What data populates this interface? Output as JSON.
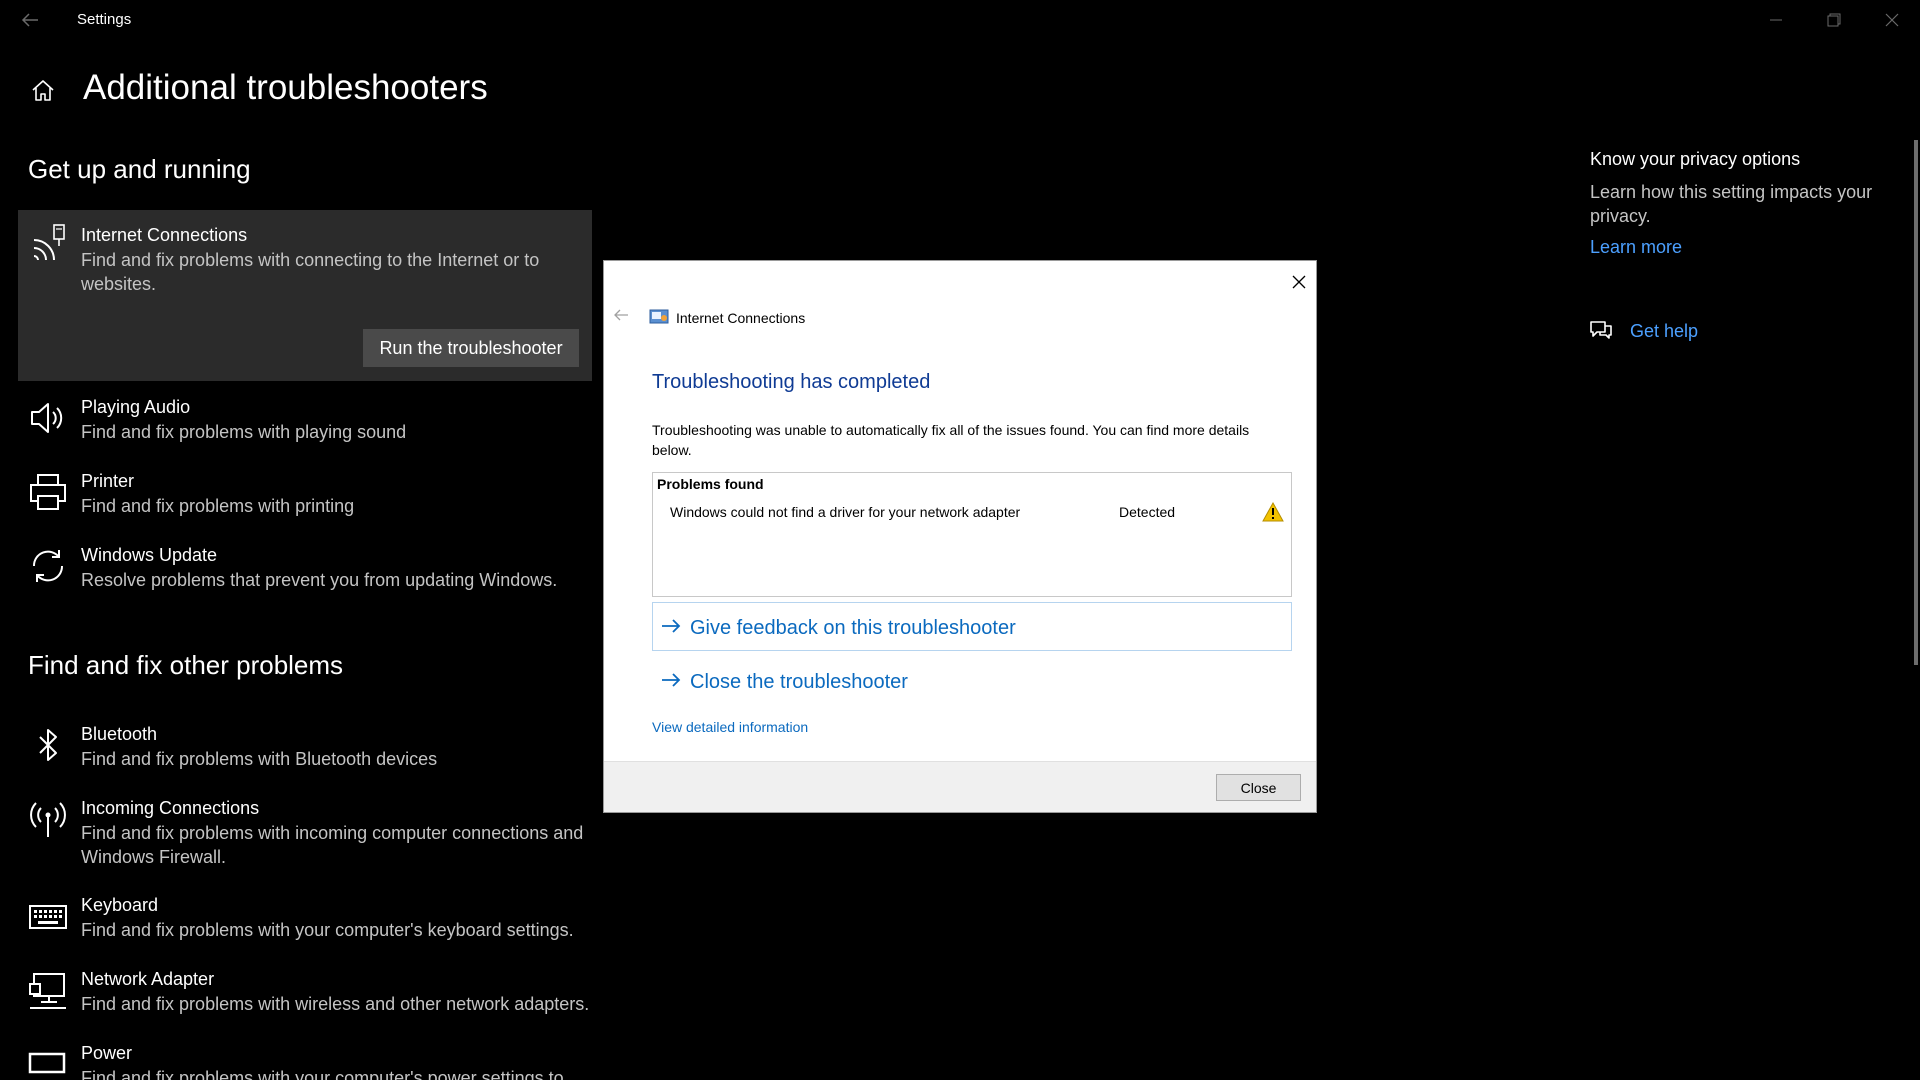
{
  "window": {
    "title": "Settings"
  },
  "header": {
    "title": "Additional troubleshooters"
  },
  "sections": {
    "get_up": "Get up and running",
    "find_fix": "Find and fix other problems"
  },
  "get_up_items": [
    {
      "name": "Internet Connections",
      "desc": "Find and fix problems with connecting to the Internet or to websites.",
      "button": "Run the troubleshooter",
      "icon": "wifi-icon"
    },
    {
      "name": "Playing Audio",
      "desc": "Find and fix problems with playing sound",
      "icon": "speaker-icon"
    },
    {
      "name": "Printer",
      "desc": "Find and fix problems with printing",
      "icon": "printer-icon"
    },
    {
      "name": "Windows Update",
      "desc": "Resolve problems that prevent you from updating Windows.",
      "icon": "refresh-icon"
    }
  ],
  "other_items": [
    {
      "name": "Bluetooth",
      "desc": "Find and fix problems with Bluetooth devices",
      "icon": "bluetooth-icon"
    },
    {
      "name": "Incoming Connections",
      "desc": "Find and fix problems with incoming computer connections and Windows Firewall.",
      "icon": "antenna-icon"
    },
    {
      "name": "Keyboard",
      "desc": "Find and fix problems with your computer's keyboard settings.",
      "icon": "keyboard-icon"
    },
    {
      "name": "Network Adapter",
      "desc": "Find and fix problems with wireless and other network adapters.",
      "icon": "monitor-network-icon"
    },
    {
      "name": "Power",
      "desc": "Find and fix problems with your computer's power settings to",
      "icon": "battery-icon"
    }
  ],
  "right_pane": {
    "privacy_title": "Know your privacy options",
    "privacy_desc": "Learn how this setting impacts your privacy.",
    "learn_more": "Learn more",
    "get_help": "Get help"
  },
  "dialog": {
    "app_title": "Internet Connections",
    "heading": "Troubleshooting has completed",
    "text": "Troubleshooting was unable to automatically fix all of the issues found. You can find more details below.",
    "problems_header": "Problems found",
    "problems": [
      {
        "name": "Windows could not find a driver for your network adapter",
        "status": "Detected"
      }
    ],
    "feedback_link": "Give feedback on this troubleshooter",
    "close_link": "Close the troubleshooter",
    "details_link": "View detailed information",
    "close_button": "Close",
    "colors": {
      "heading": "#0f3b94",
      "link": "#0b6abf"
    }
  },
  "colors": {
    "accent_link": "#4ca0ff",
    "background": "#000000"
  }
}
